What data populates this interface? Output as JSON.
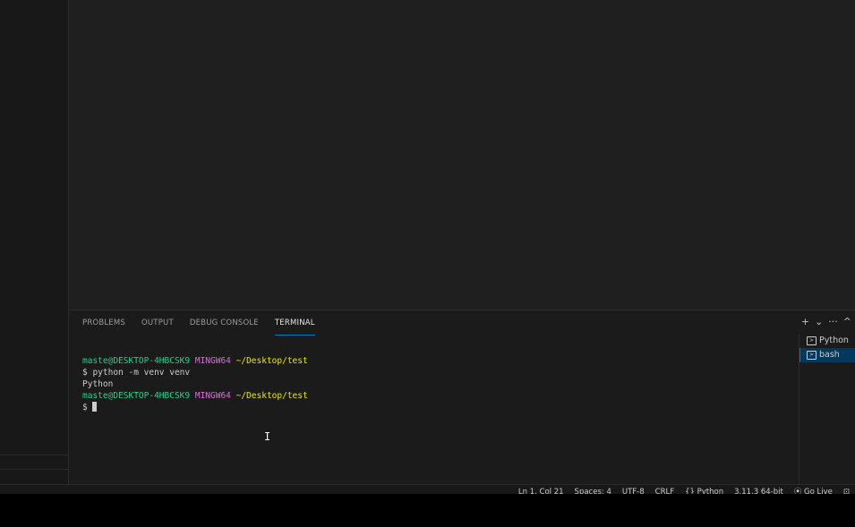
{
  "panel": {
    "tabs": [
      {
        "label": "PROBLEMS",
        "active": false
      },
      {
        "label": "OUTPUT",
        "active": false
      },
      {
        "label": "DEBUG CONSOLE",
        "active": false
      },
      {
        "label": "TERMINAL",
        "active": true
      }
    ],
    "actions": {
      "new_terminal": "+",
      "dropdown": "⌄",
      "more": "···",
      "maximize": "^"
    }
  },
  "terminal": {
    "lines": [
      {
        "user": "maste@DESKTOP-4HBCSK9",
        "host": "MINGW64",
        "path": "~/Desktop/test"
      },
      {
        "text": "$ python -m venv venv"
      },
      {
        "text": "Python"
      },
      {
        "user": "maste@DESKTOP-4HBCSK9",
        "host": "MINGW64",
        "path": "~/Desktop/test"
      },
      {
        "prompt": "$ "
      }
    ]
  },
  "terminal_list": [
    {
      "label": "Python",
      "selected": false
    },
    {
      "label": "bash",
      "selected": true
    }
  ],
  "statusbar": {
    "position": "Ln 1, Col 21",
    "spaces": "Spaces: 4",
    "encoding": "UTF-8",
    "eol": "CRLF",
    "language": "{} Python",
    "interpreter": "3.11.3 64-bit",
    "golive": "⦿ Go Live",
    "notifications": "⊡"
  },
  "colors": {
    "accent": "#0078d4",
    "terminal_user": "#23d18b",
    "terminal_host": "#d670d6",
    "terminal_path": "#e5e510"
  }
}
